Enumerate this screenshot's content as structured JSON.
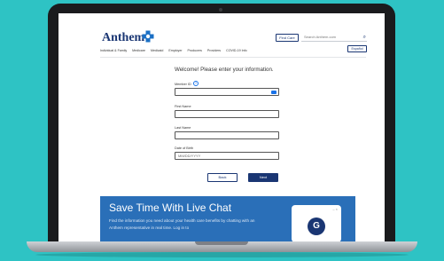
{
  "header": {
    "logo_text": "Anthem",
    "find_care_label": "Find Care",
    "search_placeholder": "Search Anthem.com",
    "espanol_label": "Español",
    "nav_items": [
      "Individual & Family",
      "Medicare",
      "Medicaid",
      "Employer",
      "Producers",
      "Providers",
      "COVID-19 Info"
    ]
  },
  "form": {
    "welcome": "Welcome! Please enter your information.",
    "member_id_label": "Member ID",
    "first_name_label": "First Name",
    "last_name_label": "Last Name",
    "dob_label": "Date of Birth",
    "dob_placeholder": "MM/DD/YYYY",
    "back_label": "Back",
    "next_label": "Next"
  },
  "banner": {
    "title": "Save Time With Live Chat",
    "text": "Find the information you need about your health care benefits by chatting with an Anthem representative in real time. Log in to",
    "chat_avatar_letter": "G"
  },
  "colors": {
    "background": "#2ec3c4",
    "brand": "#1a3673",
    "banner": "#2a6fb8",
    "accent": "#1a73e8"
  }
}
